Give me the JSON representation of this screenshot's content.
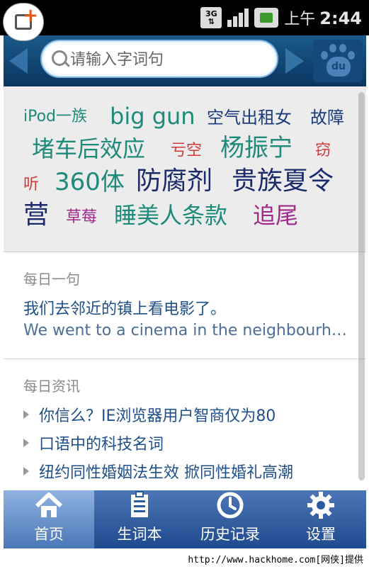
{
  "status_bar": {
    "network": "3G",
    "clock_prefix": "上午",
    "clock_time": "2:44"
  },
  "search": {
    "placeholder": "请输入字词句",
    "button_icon": "baidu-paw-icon",
    "logo_text": "du"
  },
  "tag_cloud": [
    {
      "text": "iPod一族",
      "color": "#1e8a7a"
    },
    {
      "text": "big gun",
      "color": "#1e8a7a"
    },
    {
      "text": "空气出租女",
      "color": "#1a3a7a"
    },
    {
      "text": "故障",
      "color": "#1a3a7a"
    },
    {
      "text": "堵车后效应",
      "color": "#1e8a7a"
    },
    {
      "text": "亏空",
      "color": "#d03a3a"
    },
    {
      "text": "杨振宁",
      "color": "#1e8a7a"
    },
    {
      "text": "窃",
      "color": "#d03a3a"
    },
    {
      "text": "听",
      "color": "#d03a3a"
    },
    {
      "text": "360体",
      "color": "#1e8a7a"
    },
    {
      "text": "防腐剂",
      "color": "#1a2a6a"
    },
    {
      "text": "贵族夏令",
      "color": "#1a2a6a"
    },
    {
      "text": "营",
      "color": "#1a2a6a"
    },
    {
      "text": "草莓",
      "color": "#a0288a"
    },
    {
      "text": "睡美人条款",
      "color": "#1e8a7a"
    },
    {
      "text": "追尾",
      "color": "#a0288a"
    }
  ],
  "daily_sentence": {
    "title": "每日一句",
    "chinese": "我们去邻近的镇上看电影了。",
    "english": "We went to a cinema in the neighbourhood town."
  },
  "daily_news": {
    "title": "每日资讯",
    "items": [
      "你信么？IE浏览器用户智商仅为80",
      "口语中的科技名词",
      "纽约同性婚姻法生效 掀同性婚礼高潮"
    ]
  },
  "tabs": [
    {
      "label": "首页",
      "icon": "home-icon",
      "active": true
    },
    {
      "label": "生词本",
      "icon": "notebook-icon",
      "active": false
    },
    {
      "label": "历史记录",
      "icon": "clock-icon",
      "active": false
    },
    {
      "label": "设置",
      "icon": "gear-icon",
      "active": false
    }
  ],
  "watermark": "http://www.hackhome.com[网侠]提供"
}
